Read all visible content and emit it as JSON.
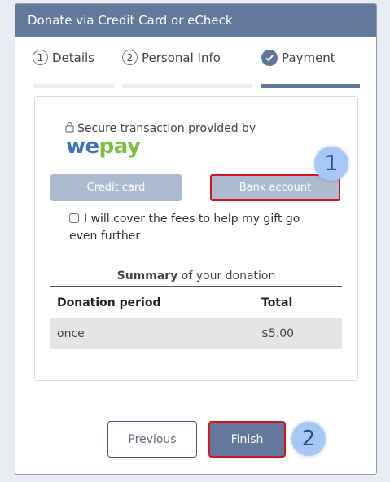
{
  "header": {
    "title": "Donate via Credit Card or eCheck"
  },
  "steps": [
    {
      "number": "1",
      "label": "Details"
    },
    {
      "number": "2",
      "label": "Personal Info"
    },
    {
      "label": "Payment",
      "icon": "checkmark-icon",
      "active": true
    }
  ],
  "secure": {
    "text": "Secure transaction provided by",
    "icon": "lock-icon"
  },
  "brand": {
    "we": "we",
    "pay": "pay"
  },
  "payment": {
    "credit_label": "Credit card",
    "bank_label": "Bank account"
  },
  "fees": {
    "label": "I will cover the fees to help my gift go even further",
    "checked": false
  },
  "summary": {
    "title_bold": "Summary",
    "title_rest": " of your donation",
    "columns": [
      "Donation period",
      "Total"
    ],
    "rows": [
      [
        "once",
        "$5.00"
      ]
    ]
  },
  "buttons": {
    "previous": "Previous",
    "finish": "Finish"
  },
  "annotations": {
    "badge1": "1",
    "badge2": "2"
  },
  "colors": {
    "header": "#63799b",
    "highlight": "#d8141c",
    "badge": "#a7c7f5",
    "brand_we": "#3b72c4",
    "brand_pay": "#7ac143"
  }
}
